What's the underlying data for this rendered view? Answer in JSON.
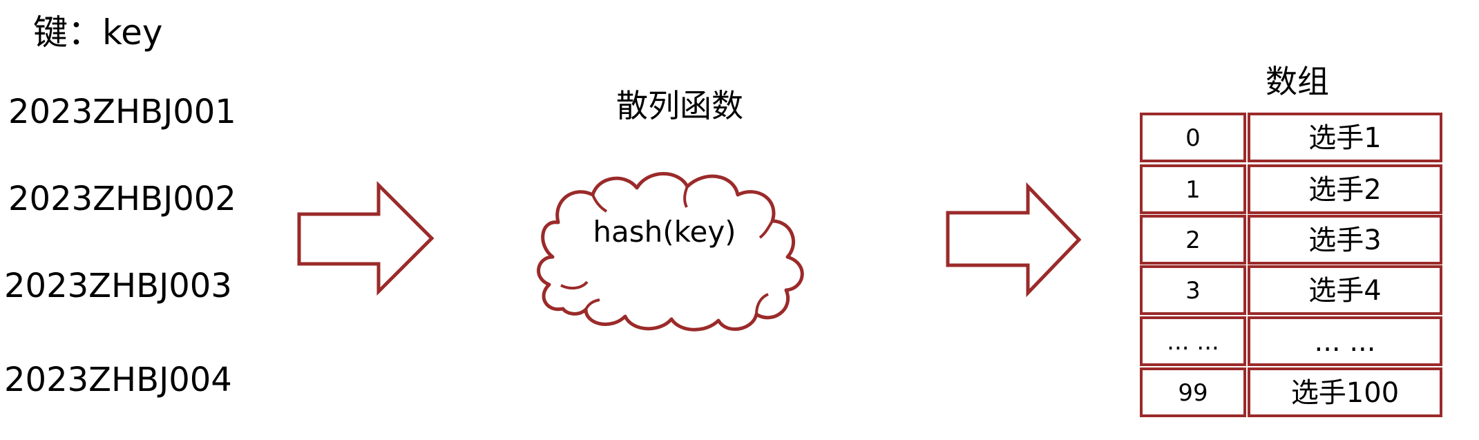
{
  "key_heading": "键：key",
  "keys": [
    "2023ZHBJ001",
    "2023ZHBJ002",
    "2023ZHBJ003",
    "2023ZHBJ004"
  ],
  "hash_title": "散列函数",
  "hash_label": "hash(key)",
  "array_title": "数组",
  "array_rows": [
    {
      "index": "0",
      "value": "选手1"
    },
    {
      "index": "1",
      "value": "选手2"
    },
    {
      "index": "2",
      "value": "选手3"
    },
    {
      "index": "3",
      "value": "选手4"
    },
    {
      "index": "... ...",
      "value": "... ..."
    },
    {
      "index": "99",
      "value": "选手100"
    }
  ],
  "colors": {
    "stroke": "#9b2a2a",
    "text": "#000000",
    "background": "#ffffff"
  }
}
